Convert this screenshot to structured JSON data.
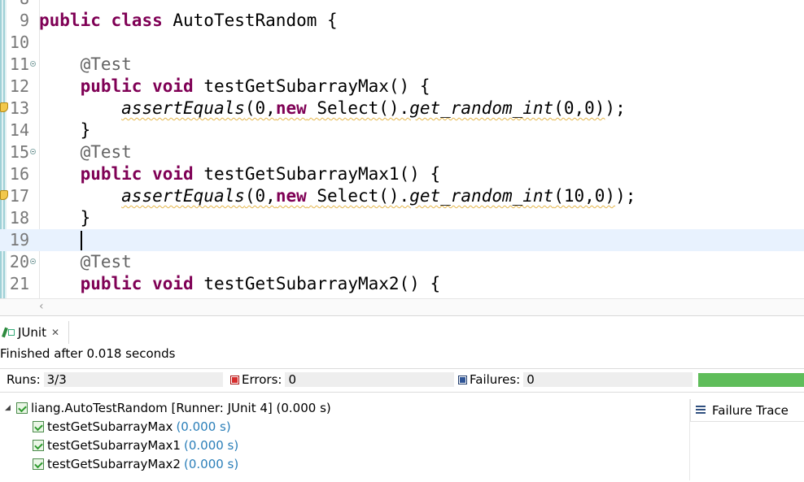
{
  "editor": {
    "lines": [
      {
        "n": "8",
        "tokens": []
      },
      {
        "n": "9",
        "tokens": [
          {
            "t": "public",
            "c": "kw"
          },
          {
            "t": " "
          },
          {
            "t": "class",
            "c": "kw"
          },
          {
            "t": " AutoTestRandom {"
          }
        ]
      },
      {
        "n": "10",
        "tokens": []
      },
      {
        "n": "11",
        "fold": true,
        "tokens": [
          {
            "t": "    "
          },
          {
            "t": "@Test",
            "c": "ann"
          }
        ]
      },
      {
        "n": "12",
        "tokens": [
          {
            "t": "    "
          },
          {
            "t": "public",
            "c": "kw"
          },
          {
            "t": " "
          },
          {
            "t": "void",
            "c": "kw"
          },
          {
            "t": " testGetSubarrayMax() {"
          }
        ]
      },
      {
        "n": "13",
        "warn": true,
        "tokens": [
          {
            "t": "        "
          },
          {
            "t": "assertEquals",
            "c": "it squig"
          },
          {
            "t": "(0,",
            "c": "squig"
          },
          {
            "t": "new",
            "c": "kw squig"
          },
          {
            "t": " Select().",
            "c": "squig"
          },
          {
            "t": "get_random_int",
            "c": "it squig"
          },
          {
            "t": "(0,0)",
            "c": "squig"
          },
          {
            "t": ");"
          }
        ]
      },
      {
        "n": "14",
        "tokens": [
          {
            "t": "    }"
          }
        ]
      },
      {
        "n": "15",
        "fold": true,
        "tokens": [
          {
            "t": "    "
          },
          {
            "t": "@Test",
            "c": "ann"
          }
        ]
      },
      {
        "n": "16",
        "tokens": [
          {
            "t": "    "
          },
          {
            "t": "public",
            "c": "kw"
          },
          {
            "t": " "
          },
          {
            "t": "void",
            "c": "kw"
          },
          {
            "t": " testGetSubarrayMax1() {"
          }
        ]
      },
      {
        "n": "17",
        "warn": true,
        "tokens": [
          {
            "t": "        "
          },
          {
            "t": "assertEquals",
            "c": "it squig"
          },
          {
            "t": "(0,",
            "c": "squig"
          },
          {
            "t": "new",
            "c": "kw squig"
          },
          {
            "t": " Select().",
            "c": "squig"
          },
          {
            "t": "get_random_int",
            "c": "it squig"
          },
          {
            "t": "(10,0)",
            "c": "squig"
          },
          {
            "t": ");"
          }
        ]
      },
      {
        "n": "18",
        "tokens": [
          {
            "t": "    }"
          }
        ]
      },
      {
        "n": "19",
        "current": true,
        "caret": true,
        "tokens": [
          {
            "t": "    "
          }
        ]
      },
      {
        "n": "20",
        "fold": true,
        "tokens": [
          {
            "t": "    "
          },
          {
            "t": "@Test",
            "c": "ann"
          }
        ]
      },
      {
        "n": "21",
        "tokens": [
          {
            "t": "    "
          },
          {
            "t": "public",
            "c": "kw"
          },
          {
            "t": " "
          },
          {
            "t": "void",
            "c": "kw"
          },
          {
            "t": " testGetSubarrayMax2() {"
          }
        ]
      }
    ],
    "scroll_left_icon": "chevron-left-icon"
  },
  "junit": {
    "tab_label": "JUnit",
    "tab_icon": "junit-icon",
    "close_glyph": "✕",
    "status": "Finished after 0.018 seconds",
    "runs_label": "Runs:",
    "runs_value": "3/3",
    "errors_label": "Errors:",
    "errors_value": "0",
    "failures_label": "Failures:",
    "failures_value": "0",
    "bar_color": "#5fbd5a",
    "tree": {
      "root": {
        "label": "liang.AutoTestRandom [Runner: JUnit 4] (0.000 s)"
      },
      "children": [
        {
          "name": "testGetSubarrayMax",
          "time": "(0.000 s)"
        },
        {
          "name": "testGetSubarrayMax1",
          "time": "(0.000 s)"
        },
        {
          "name": "testGetSubarrayMax2",
          "time": "(0.000 s)"
        }
      ]
    },
    "failure_trace_label": "Failure Trace"
  }
}
